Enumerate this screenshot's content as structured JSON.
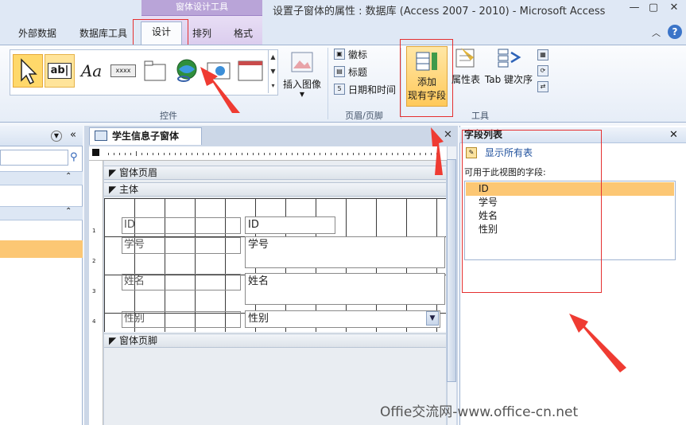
{
  "window": {
    "context_tab_header": "窗体设计工具",
    "title": "设置子窗体的属性 : 数据库 (Access 2007 - 2010)  -  Microsoft Access",
    "minimize": "—",
    "restore": "▢",
    "close": "✕",
    "help": "?"
  },
  "tabs": {
    "external": "外部数据",
    "dbtools": "数据库工具",
    "design": "设计",
    "arrange": "排列",
    "format": "格式"
  },
  "ribbon": {
    "controls": {
      "group_label": "控件",
      "textbox_icon_text": "ab|",
      "label_icon_text": "Aa",
      "button_icon_text": "xxxx",
      "insert_image_label": "插入图像"
    },
    "header_footer": {
      "group_label": "页眉/页脚",
      "logo": "徽标",
      "title": "标题",
      "datetime": "日期和时间"
    },
    "tools": {
      "group_label": "工具",
      "add_fields_line1": "添加",
      "add_fields_line2": "现有字段",
      "property_sheet": "属性表",
      "tab_order": "Tab 键次序"
    }
  },
  "document": {
    "tab_title": "学生信息子窗体",
    "sections": {
      "header": "窗体页眉",
      "detail": "主体",
      "footer": "窗体页脚"
    },
    "fields": [
      {
        "label": "ID",
        "control": "ID"
      },
      {
        "label": "学号",
        "control": "学号"
      },
      {
        "label": "姓名",
        "control": "姓名"
      },
      {
        "label": "性别",
        "control": "性别"
      }
    ],
    "ruler_numbers": [
      "1",
      "2",
      "3",
      "4"
    ]
  },
  "field_list": {
    "title": "字段列表",
    "show_all": "显示所有表",
    "available_label": "可用于此视图的字段:",
    "items": [
      "ID",
      "学号",
      "姓名",
      "性别"
    ]
  },
  "watermark": "Offie交流网-www.office-cn.net",
  "colors": {
    "selected": "#fcc774",
    "annotation": "#e53030",
    "context_tab": "#b9a4d8"
  }
}
